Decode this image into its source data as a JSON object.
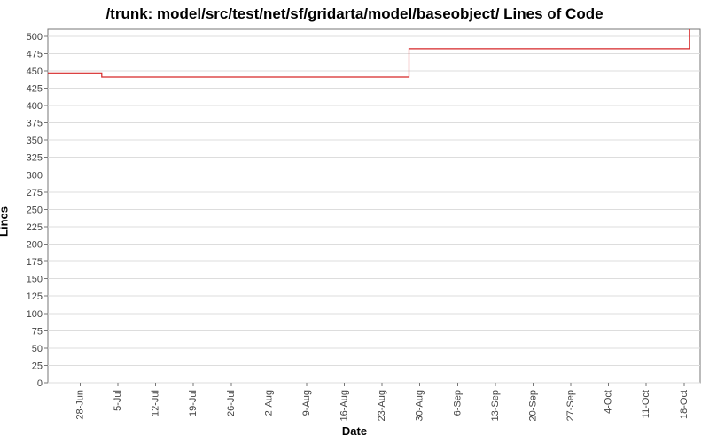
{
  "chart_data": {
    "type": "line",
    "title": "/trunk: model/src/test/net/sf/gridarta/model/baseobject/ Lines of Code",
    "xlabel": "Date",
    "ylabel": "Lines",
    "ylim": [
      0,
      510
    ],
    "y_ticks": [
      0,
      25,
      50,
      75,
      100,
      125,
      150,
      175,
      200,
      225,
      250,
      275,
      300,
      325,
      350,
      375,
      400,
      425,
      450,
      475,
      500
    ],
    "x_ticks": [
      "28-Jun",
      "5-Jul",
      "12-Jul",
      "19-Jul",
      "26-Jul",
      "2-Aug",
      "9-Aug",
      "16-Aug",
      "23-Aug",
      "30-Aug",
      "6-Sep",
      "13-Sep",
      "20-Sep",
      "27-Sep",
      "4-Oct",
      "11-Oct",
      "18-Oct"
    ],
    "series": [
      {
        "name": "Lines of Code",
        "color": "#d62728",
        "points": [
          {
            "x": "22-Jun",
            "y": 447
          },
          {
            "x": "2-Jul",
            "y": 447
          },
          {
            "x": "2-Jul",
            "y": 441
          },
          {
            "x": "28-Aug",
            "y": 441
          },
          {
            "x": "28-Aug",
            "y": 482
          },
          {
            "x": "19-Oct",
            "y": 482
          },
          {
            "x": "19-Oct",
            "y": 510
          }
        ]
      }
    ]
  }
}
